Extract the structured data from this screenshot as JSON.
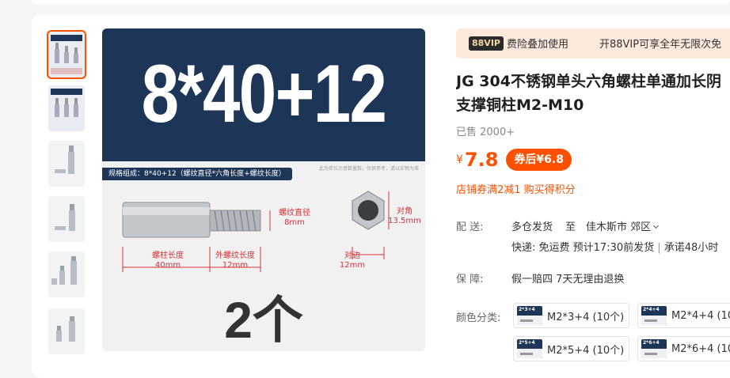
{
  "gallery": {
    "main_label": "8*40+12",
    "spec_tag": "规格组成：8*40+12（螺纹直径*六角长度+螺纹长度）",
    "notice": "此为单位示意数量数，仅供参考，请以实物为准",
    "dims": {
      "thread_diameter": "螺纹直径",
      "thread_diameter_val": "8mm",
      "diagonal": "对角",
      "diagonal_val": "13.5mm",
      "pillar_length": "螺柱长度",
      "pillar_length_val": "40mm",
      "outer_thread": "外螺纹长度",
      "outer_thread_val": "12mm",
      "flat": "对边",
      "flat_val": "12mm"
    },
    "quantity": "2个"
  },
  "vip": {
    "badge": "88VIP",
    "text": "费险叠加使用",
    "text2": "开88VIP可享全年无限次免"
  },
  "product": {
    "title_line1": "JG 304不锈钢单头六角螺柱单通加长阴",
    "title_line2": "支撑铜柱M2-M10",
    "sold": "已售 2000+",
    "currency": "¥",
    "price": "7.8",
    "coupon_price": "券后¥6.8",
    "promo": "店铺券满2减1 购买得积分"
  },
  "delivery": {
    "label": "配  送:",
    "from": "多仓发货",
    "to_word": "至",
    "destination": "佳木斯市 郊区",
    "line2": "快递: 免运费  预计17:30前发货",
    "pipe": "|",
    "promise": "承诺48小时"
  },
  "guarantee": {
    "label": "保  障:",
    "value": "假一赔四 7天无理由退换"
  },
  "options": {
    "label": "颜色分类:",
    "items": [
      {
        "thumb": "2*3+4",
        "label": "M2*3+4 (10个)"
      },
      {
        "thumb": "2*4+4",
        "label": "M2*4+4 (10"
      },
      {
        "thumb": "2*5+4",
        "label": "M2*5+4 (10个)"
      },
      {
        "thumb": "2*6+4",
        "label": "M2*6+4 (10"
      }
    ]
  }
}
